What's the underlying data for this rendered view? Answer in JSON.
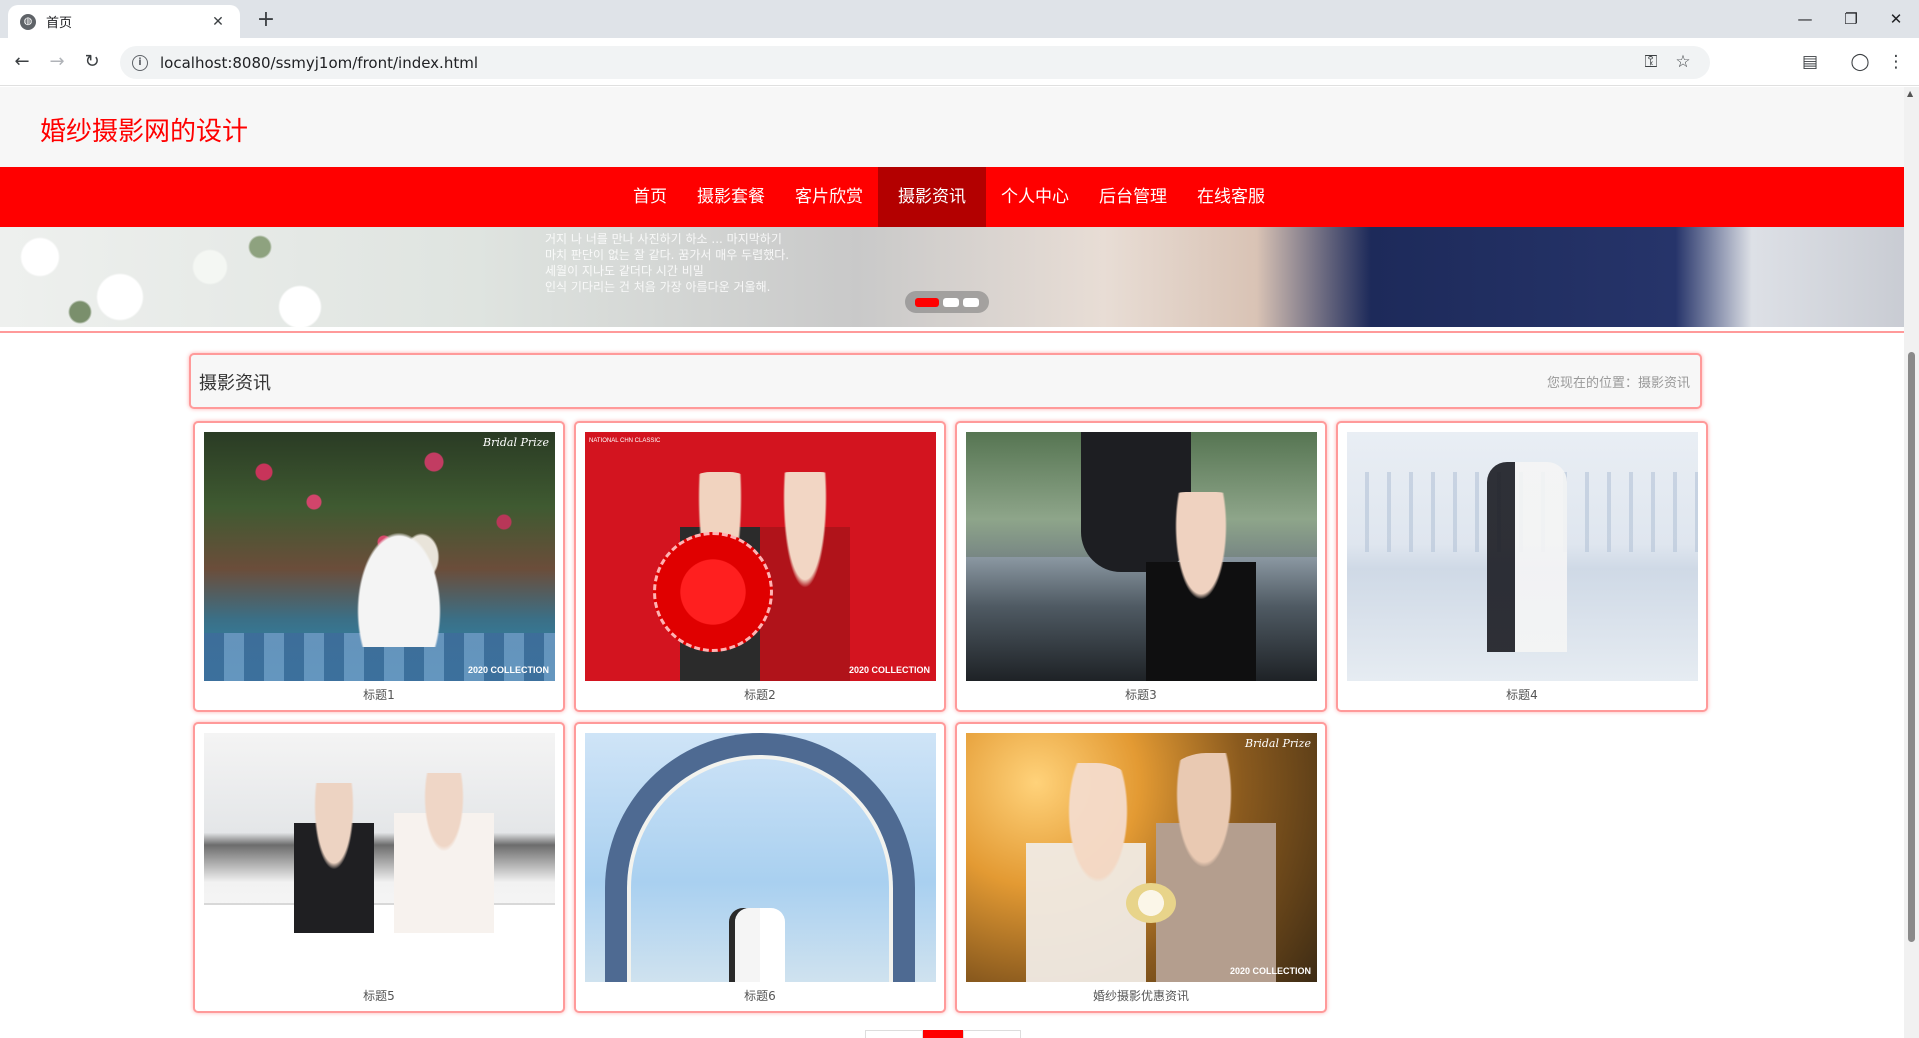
{
  "browser": {
    "tab_title": "首页",
    "url": "localhost:8080/ssmyj1om/front/index.html"
  },
  "site": {
    "title": "婚纱摄影网的设计"
  },
  "nav": {
    "items": [
      "首页",
      "摄影套餐",
      "客片欣赏",
      "摄影资讯",
      "个人中心",
      "后台管理",
      "在线客服"
    ],
    "active_index": 3
  },
  "banner": {
    "text_lines": [
      "거지 나 너를 만나 사진하기 하소 ... 마지막하기",
      "마치 판단이 없는 잘 같다. 꿈가서 매우 두렵했다.",
      "세월이 지나도 같더다 시간 비밀",
      "인식 기다리는 건 처음 가장 아름다운 거울해."
    ],
    "slide_count": 3,
    "active_slide": 0
  },
  "section": {
    "title": "摄影资讯",
    "location_label": "您现在的位置：摄影资讯"
  },
  "news": [
    {
      "caption": "标题1",
      "watermark": "Bridal Prize",
      "badge": "2020 COLLECTION"
    },
    {
      "caption": "标题2",
      "watermark": "NATIONAL CHN CLASSIC",
      "badge": "2020 COLLECTION"
    },
    {
      "caption": "标题3"
    },
    {
      "caption": "标题4"
    },
    {
      "caption": "标题5"
    },
    {
      "caption": "标题6"
    },
    {
      "caption": "婚纱摄影优惠资讯",
      "watermark": "Bridal Prize",
      "badge": "2020 COLLECTION"
    }
  ],
  "colors": {
    "accent": "#ff0000",
    "nav_active": "#b30000",
    "card_border": "#ff9a9a"
  }
}
